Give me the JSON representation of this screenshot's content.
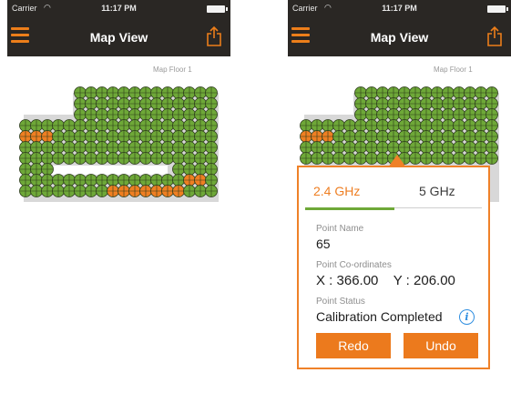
{
  "status_bar": {
    "carrier": "Carrier",
    "time": "11:17 PM"
  },
  "nav": {
    "title": "Map View"
  },
  "map": {
    "floor_label": "Map Floor 1"
  },
  "popup": {
    "tabs": [
      {
        "label": "2.4 GHz",
        "active": true
      },
      {
        "label": "5 GHz",
        "active": false
      }
    ],
    "point_name_label": "Point Name",
    "point_name_value": "65",
    "coordinates_label": "Point Co-ordinates",
    "coordinates_value": "X : 366.00    Y : 206.00",
    "status_label": "Point Status",
    "status_value": "Calibration Completed",
    "redo_label": "Redo",
    "undo_label": "Undo"
  },
  "colors": {
    "bar": "#2a2724",
    "accent": "#ec7e1a",
    "point_done": "#6ea838",
    "point_pending": "#ef7f22",
    "info": "#2f8ee0"
  }
}
